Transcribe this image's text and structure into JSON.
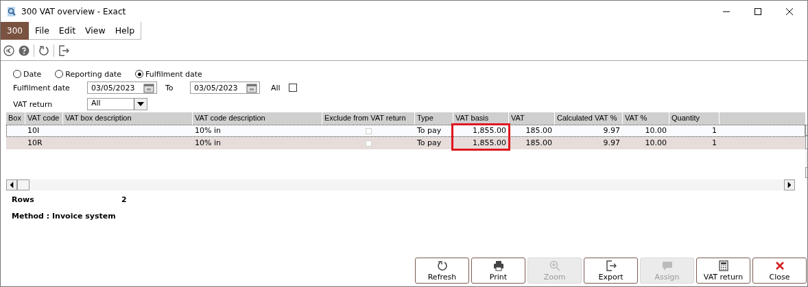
{
  "window": {
    "title": "300 VAT overview - Exact"
  },
  "menu": {
    "company": "300",
    "items": [
      "File",
      "Edit",
      "View",
      "Help"
    ]
  },
  "filters": {
    "radios": [
      {
        "label": "Date",
        "selected": false
      },
      {
        "label": "Reporting date",
        "selected": false
      },
      {
        "label": "Fulfilment date",
        "selected": true
      }
    ],
    "date_label": "Fulfilment date",
    "date_from": "03/05/2023",
    "to_label": "To",
    "date_to": "03/05/2023",
    "all_label": "All",
    "all_checked": false,
    "vat_return_label": "VAT return",
    "vat_return_value": "All"
  },
  "table": {
    "columns": [
      {
        "label": "Box",
        "kind": "text",
        "highlighted": false
      },
      {
        "label": "VAT code",
        "kind": "text",
        "highlighted": false
      },
      {
        "label": "VAT box description",
        "kind": "text",
        "highlighted": false
      },
      {
        "label": "VAT code description",
        "kind": "text",
        "highlighted": false
      },
      {
        "label": "Exclude from VAT return",
        "kind": "check",
        "highlighted": false
      },
      {
        "label": "Type",
        "kind": "text",
        "highlighted": false
      },
      {
        "label": "VAT basis",
        "kind": "number",
        "highlighted": true
      },
      {
        "label": "VAT",
        "kind": "number",
        "highlighted": false
      },
      {
        "label": "Calculated VAT %",
        "kind": "number",
        "highlighted": false
      },
      {
        "label": "VAT %",
        "kind": "number",
        "highlighted": false
      },
      {
        "label": "Quantity",
        "kind": "number",
        "highlighted": false
      }
    ],
    "rows": [
      {
        "selected": true,
        "cells": [
          "",
          "10I",
          "",
          "10% in",
          false,
          "To pay",
          "1,855.00",
          "185.00",
          "9.97",
          "10.00",
          "1"
        ]
      },
      {
        "selected": false,
        "cells": [
          "",
          "10R",
          "",
          "10% in",
          false,
          "To pay",
          "1,855.00",
          "185.00",
          "9.97",
          "10.00",
          "1"
        ]
      }
    ]
  },
  "summary": {
    "rows_label": "Rows",
    "rows_value": "2",
    "method": "Method : Invoice system"
  },
  "buttons": [
    {
      "label": "Refresh",
      "kind": "refresh",
      "disabled": false
    },
    {
      "label": "Print",
      "kind": "print",
      "disabled": false
    },
    {
      "label": "Zoom",
      "kind": "zoom",
      "disabled": true
    },
    {
      "label": "Export",
      "kind": "export",
      "disabled": false
    },
    {
      "label": "Assign",
      "kind": "assign",
      "disabled": true
    },
    {
      "label": "VAT return",
      "kind": "calc",
      "disabled": false
    },
    {
      "label": "Close",
      "kind": "close",
      "disabled": false
    }
  ]
}
